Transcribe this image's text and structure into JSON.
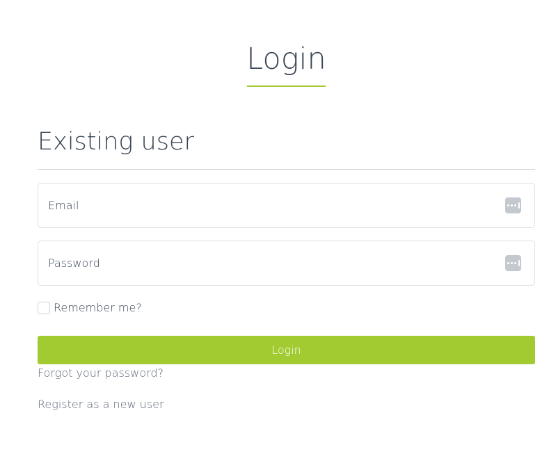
{
  "page": {
    "title": "Login"
  },
  "section": {
    "title": "Existing user"
  },
  "form": {
    "email_label": "Email",
    "password_label": "Password",
    "remember_label": "Remember me?",
    "remember_checked": false,
    "submit_label": "Login"
  },
  "links": {
    "forgot_password": "Forgot your password?",
    "register": "Register as a new user"
  },
  "icons": {
    "password_manager": "password-manager-icon"
  },
  "colors": {
    "accent": "#a2cb31",
    "text": "#3a4656",
    "link": "#5c6578"
  }
}
